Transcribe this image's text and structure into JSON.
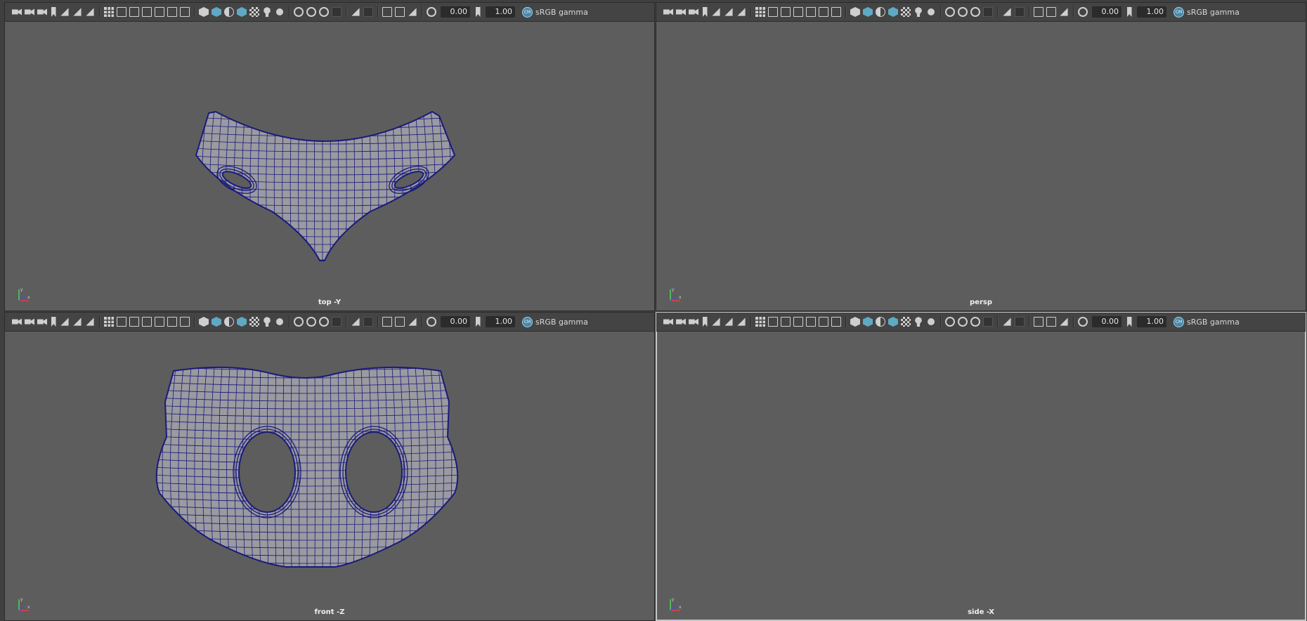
{
  "viewports": [
    {
      "camera_label": "top -Y",
      "exposure": "0.00",
      "gamma": "1.00",
      "color_space": "sRGB gamma"
    },
    {
      "camera_label": "persp",
      "exposure": "0.00",
      "gamma": "1.00",
      "color_space": "sRGB gamma"
    },
    {
      "camera_label": "front -Z",
      "exposure": "0.00",
      "gamma": "1.00",
      "color_space": "sRGB gamma"
    },
    {
      "camera_label": "side -X",
      "exposure": "0.00",
      "gamma": "1.00",
      "color_space": "sRGB gamma"
    }
  ],
  "colors": {
    "viewport_bg": "#5d5d5d",
    "mesh_fill": "#9a9aa0",
    "wireframe": "#1a1a7a",
    "active_icon": "#5fa9c4"
  },
  "icons": [
    "camera-icon",
    "grid-icon",
    "wireframe-icon",
    "smooth-shade-icon",
    "lighting-icon",
    "textures-icon",
    "exposure-icon",
    "gamma-icon",
    "color-management-icon"
  ]
}
